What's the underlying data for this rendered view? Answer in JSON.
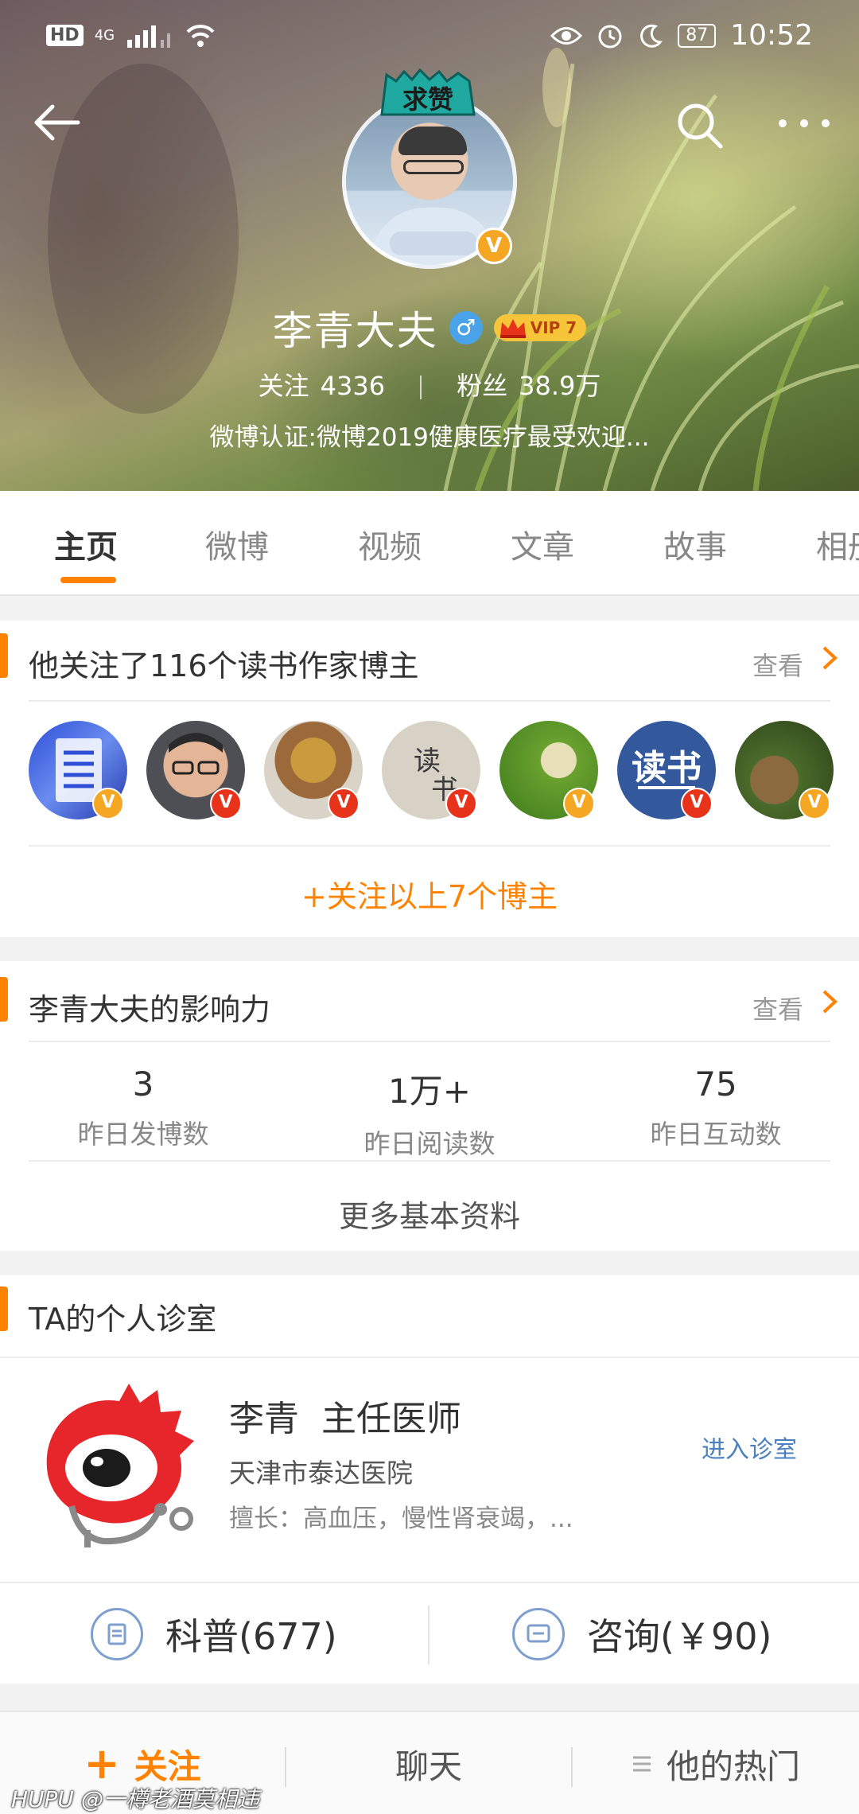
{
  "status_bar": {
    "network": "4G",
    "battery": "87",
    "time": "10:52"
  },
  "profile": {
    "badge": "求赞",
    "name": "李青大夫",
    "gender_symbol": "♂",
    "vip": "VIP 7",
    "following_label": "关注",
    "following_count": "4336",
    "fans_label": "粉丝",
    "fans_count": "38.9万",
    "verification": "微博认证:微博2019健康医疗最受欢迎..."
  },
  "tabs": [
    {
      "label": "主页",
      "active": true
    },
    {
      "label": "微博",
      "active": false
    },
    {
      "label": "视频",
      "active": false
    },
    {
      "label": "文章",
      "active": false
    },
    {
      "label": "故事",
      "active": false
    },
    {
      "label": "相册",
      "active": false
    }
  ],
  "follow_card": {
    "title": "他关注了116个读书作家博主",
    "more": "查看",
    "follow_all": "+关注以上7个博主"
  },
  "influence_card": {
    "title": "李青大夫的影响力",
    "more": "查看",
    "stats": [
      {
        "value": "3",
        "label": "昨日发博数"
      },
      {
        "value": "1万+",
        "label": "昨日阅读数"
      },
      {
        "value": "75",
        "label": "昨日互动数"
      }
    ],
    "more_info": "更多基本资料"
  },
  "clinic_card": {
    "title": "TA的个人诊室",
    "doctor_name": "李青  主任医师",
    "hospital": "天津市泰达医院",
    "specialty": "擅长：高血压，慢性肾衰竭，...",
    "enter": "进入诊室",
    "science_label": "科普(677)",
    "consult_label": "咨询(￥90)"
  },
  "bottom_bar": {
    "follow": "关注",
    "chat": "聊天",
    "hot": "他的热门"
  },
  "watermark": "HUPU @一樽老酒莫相违",
  "colors": {
    "accent": "#ff8200",
    "link_blue": "#4a7fc0",
    "verified_yellow": "#f5a623",
    "verified_red": "#e8331b"
  }
}
